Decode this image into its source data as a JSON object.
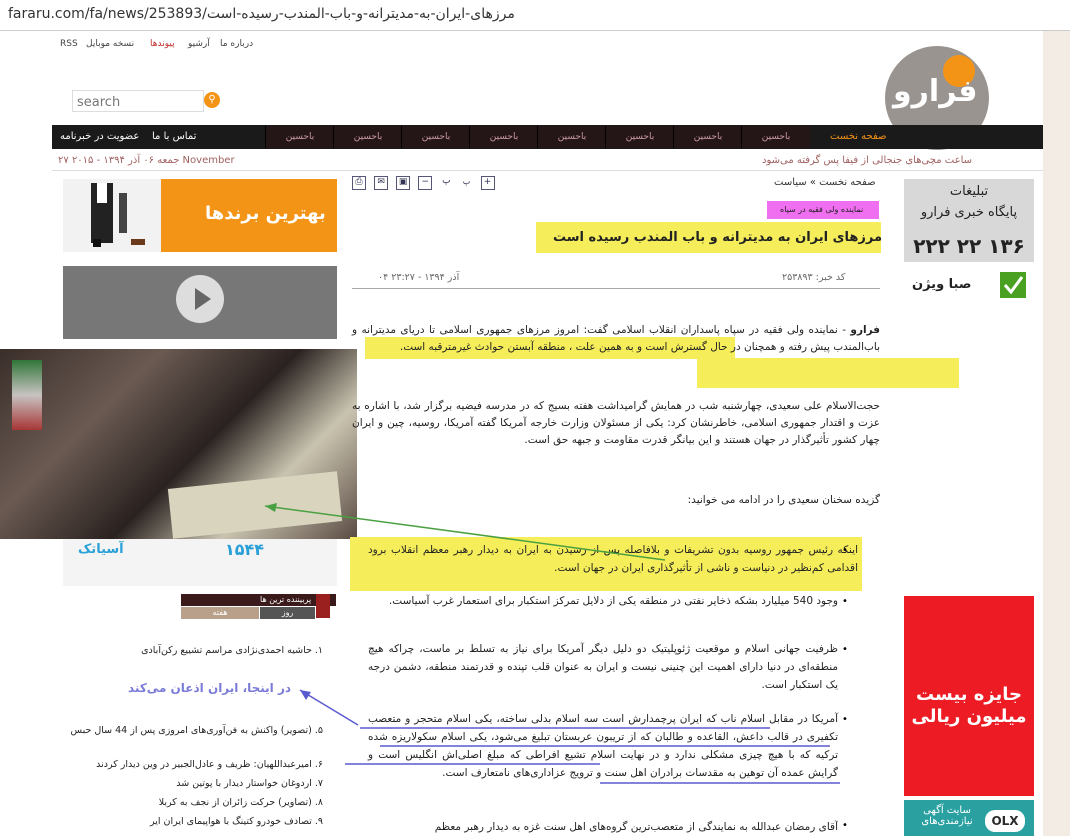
{
  "browser": {
    "url": "fararu.com/fa/news/253893/مرزهای-ایران-به-مدیترانه-و-باب-المندب-رسیده-است"
  },
  "header": {
    "top_links": [
      "RSS",
      "نسخه موبایل",
      "پیوندها",
      "آرشیو",
      "درباره ما"
    ],
    "search_placeholder": "search",
    "logo_text": "فرارو"
  },
  "nav": {
    "home": "صفحه نخست",
    "contact": "تماس با ما",
    "newsletter": "عضویت در خبرنامه",
    "sponsor_items": [
      "باحسین",
      "باحسین",
      "باحسین",
      "باحسین",
      "باحسین",
      "باحسین",
      "باحسین",
      "باحسین",
      "باحسین"
    ]
  },
  "date_line": "جمعه ۰۶ آذر ۱۳۹۴ - ۲۰۱۵ ۲۷ November",
  "ticker": "ساعت مچی‌های جنجالی از فیفا پس گرفته می‌شود",
  "left_column": {
    "ad_brands": "بهترین برندها",
    "asia_ad_text": "آسیاتک",
    "asia_ad_number": "۱۵۴۴",
    "most_read": {
      "title": "پربیننده ترین ها",
      "tab_day": "روز",
      "tab_week": "هفته",
      "items": [
        "۱. حاشیه احمدی‌نژادی مراسم تشییع رکن‌آبادی",
        "۵. (تصویر) واکنش به فن‌آوری‌های امروزی پس از 44 سال حبس",
        "۶. امیرعبداللهیان: ظریف و عادل‌الجبیر در وین دیدار کردند",
        "۷. اردوغان خواستار دیدار با پوتین شد",
        "۸. (تصاویر) حرکت زائران از نجف به کربلا",
        "۹. تصادف خودرو کتینگ با هواپیمای ایران ایر"
      ]
    },
    "annotation": "در اینجا، ایران اذعان می‌کند"
  },
  "article": {
    "breadcrumb": "صفحه نخست » سیاست",
    "tools": [
      "print-icon",
      "email-icon",
      "save-icon",
      "minus-icon",
      "font-p",
      "font-p-small",
      "plus-icon"
    ],
    "tag": "نماینده ولی فقیه در سپاه",
    "title": "مرزهای ایران به مدیترانه و باب المندب رسیده است",
    "code": "کد خبر: ۲۵۳۸۹۳",
    "date": "۰۴ آذر ۱۳۹۴ - ۲۳:۲۷",
    "lead_source": "فرارو",
    "lead": " - نماینده ولی فقیه در سپاه پاسداران انقلاب اسلامی گفت: امروز مرزهای جمهوری اسلامی تا دریای مدیترانه و باب‌المندب پیش رفته و همچنان در حال گسترش است و به همین علت ، منطقه آبستن حوادث غیرمترقبه است.",
    "para2": "حجت‌الاسلام علی سعیدی، چهارشنبه شب در همایش گرامیداشت هفته بسیج که در مدرسه فیضیه برگزار شد، با اشاره به عزت و اقتدار جمهوری اسلامی، خاطرنشان کرد: یکی از مسئولان وزارت خارجه آمریکا گفته آمریکا، روسیه، چین و ایران چهار کشور تأثیرگذار در جهان هستند و این بیانگر قدرت مقاومت و جبهه حق است.",
    "para3": "گزیده سخنان سعیدی را در ادامه می خوانید:",
    "bullets": [
      "اینکه رئیس جمهور روسیه بدون تشریفات و بلافاصله پس از رسیدن به ایران به دیدار رهبر معظم انقلاب برود اقدامی کم‌نظیر در دنیاست و ناشی از تأثیرگذاری ایران در جهان است.",
      "وجود 540 میلیارد بشکه ذخایر نفتی در منطقه یکی از دلایل تمرکز استکبار برای استعمار غرب آسیاست.",
      "ظرفیت جهانی اسلام و موقعیت ژئوپلیتیک دو دلیل دیگر آمریکا برای نیاز به تسلط بر ماست، چراکه هیچ منطقه‌ای در دنیا دارای اهمیت این چنینی نیست و ایران به عنوان قلب تپنده و قدرتمند منطقه، دشمن درجه یک استکبار است.",
      "آمریکا در مقابل اسلام ناب که ایران پرچمدارش است سه اسلام بدلی ساخته، یکی اسلام متحجر و متعصب تکفیری در قالب داعش، القاعده و طالبان که از تریبون عربستان تبلیغ می‌شود، یکی اسلام سکولاریزه شده ترکیه که با هیچ چیزی مشکلی ندارد و در نهایت اسلام تشیع افراطی که مبلغ اصلی‌اش انگلیس است و گرایش عمده آن توهین به مقدسات برادران اهل سنت و ترویج عزاداری‌های نامتعارف است.",
      "آقای رمضان عبدالله به نمایندگی از متعصب‌ترین گروه‌های اهل سنت غزه به دیدار رهبر معظم"
    ]
  },
  "right_column": {
    "tabligh_title": "تبلیغات",
    "tabligh_sub": "پایگاه خبری فرارو",
    "tabligh_phone": "۲۲۲ ۲۲ ۱۳۶",
    "saba": "صبا ویژن",
    "red_ad_line1": "جایزه بیست",
    "red_ad_line2": "میلیون ریالی",
    "olx_text": "سایت آگهی نیازمندی‌های",
    "olx_logo": "OLX"
  },
  "colors": {
    "accent_orange": "#f39416",
    "highlight_yellow": "#f5ee5a",
    "tag_magenta": "#f06ef0",
    "nav_black": "#1a1a1a",
    "ad_red": "#ed1c24",
    "annotation_blue": "#7b7bd8"
  }
}
